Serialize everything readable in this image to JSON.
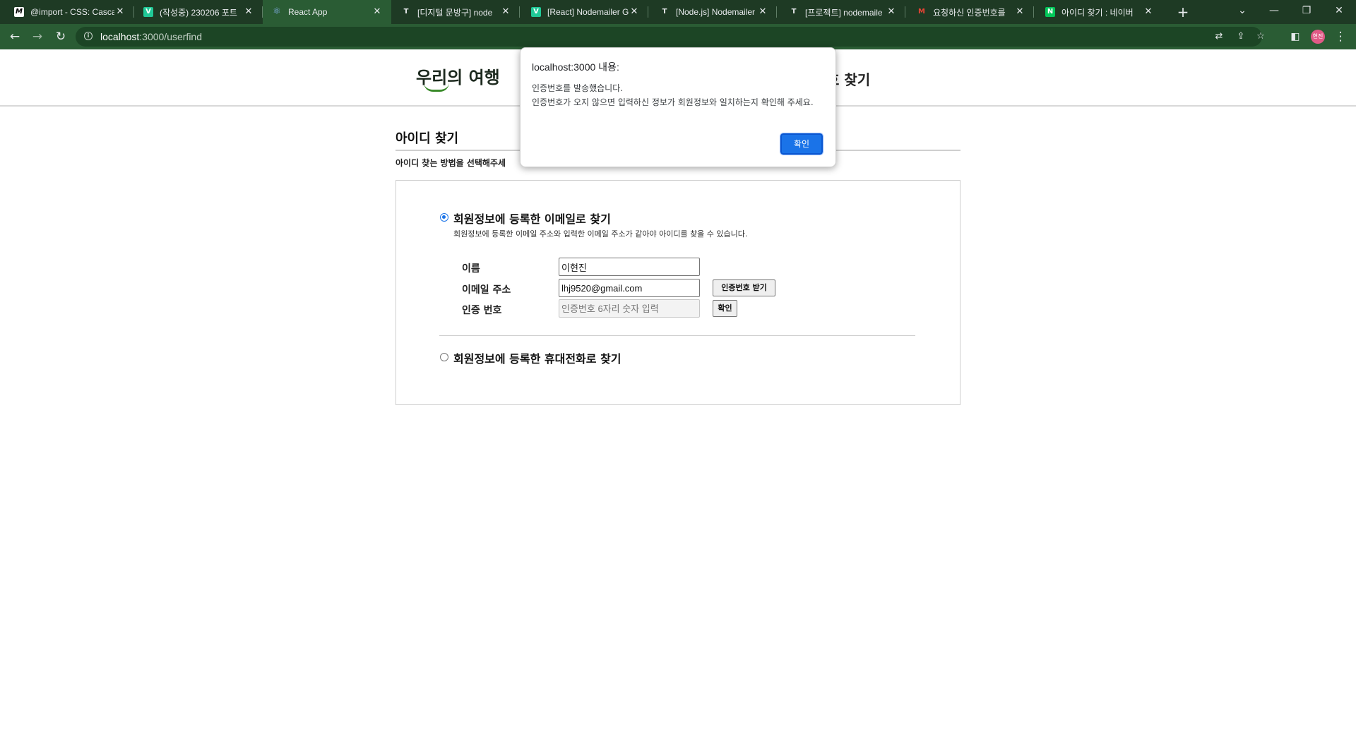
{
  "browser": {
    "tabs": [
      {
        "title": "@import - CSS: Cascad",
        "icon": "mdn-icon",
        "favicon_text": "M",
        "favicon_bg": "#ffffff",
        "favicon_fg": "#000000"
      },
      {
        "title": "(작성중) 230206 포트",
        "icon": "velog-icon",
        "favicon_text": "V",
        "favicon_bg": "#20c997",
        "favicon_fg": "#ffffff"
      },
      {
        "title": "React App",
        "icon": "react-icon",
        "favicon_text": "⚛",
        "favicon_bg": "transparent",
        "favicon_fg": "#8ab4f8"
      },
      {
        "title": "[디지털 문방구] node",
        "icon": "tistory-icon",
        "favicon_text": "T",
        "favicon_bg": "transparent",
        "favicon_fg": "#e8eaed"
      },
      {
        "title": "[React] Nodemailer G",
        "icon": "velog-icon",
        "favicon_text": "V",
        "favicon_bg": "#20c997",
        "favicon_fg": "#ffffff"
      },
      {
        "title": "[Node.js] Nodemailer",
        "icon": "tistory-icon",
        "favicon_text": "T",
        "favicon_bg": "transparent",
        "favicon_fg": "#e8eaed"
      },
      {
        "title": "[프로젝트] nodemaile",
        "icon": "tistory-icon",
        "favicon_text": "T",
        "favicon_bg": "transparent",
        "favicon_fg": "#e8eaed"
      },
      {
        "title": "요청하신 인증번호를",
        "icon": "gmail-icon",
        "favicon_text": "M",
        "favicon_bg": "transparent",
        "favicon_fg": "#ea4335"
      },
      {
        "title": "아이디 찾기 : 네이버",
        "icon": "naver-icon",
        "favicon_text": "N",
        "favicon_bg": "#03c75a",
        "favicon_fg": "#ffffff"
      }
    ],
    "active_tab": 2,
    "url_host": "localhost",
    "url_path": ":3000/userfind",
    "profile_initials": "현진"
  },
  "site": {
    "logo": "우리의 여행",
    "header_link": "호 찾기"
  },
  "find": {
    "title": "아이디 찾기",
    "desc": "아이디 찾는 방법을 선택해주세",
    "email_option": {
      "label": "회원정보에 등록한 이메일로 찾기",
      "desc": "회원정보에 등록한 이메일 주소와 입력한 이메일 주소가 같아야 아이디를 찾을 수 있습니다.",
      "selected": true
    },
    "name_label": "이름",
    "name_value": "이현진",
    "email_label": "이메일 주소",
    "email_value": "lhj9520@gmail.com",
    "send_code_button": "인증번호 받기",
    "code_label": "인증 번호",
    "code_placeholder": "인증번호 6자리 숫자 입력",
    "confirm_button": "확인",
    "phone_option": {
      "label": "회원정보에 등록한 휴대전화로 찾기",
      "selected": false
    }
  },
  "alert": {
    "title": "localhost:3000 내용:",
    "line1": "인증번호를 발송했습니다.",
    "line2": "인증번호가 오지 않으면 입력하신 정보가 회원정보와 일치하는지 확인해 주세요.",
    "ok": "확인"
  },
  "colors": {
    "browser_frame": "#1e3a24",
    "toolbar": "#2a5c34",
    "accent": "#1a73e8"
  }
}
